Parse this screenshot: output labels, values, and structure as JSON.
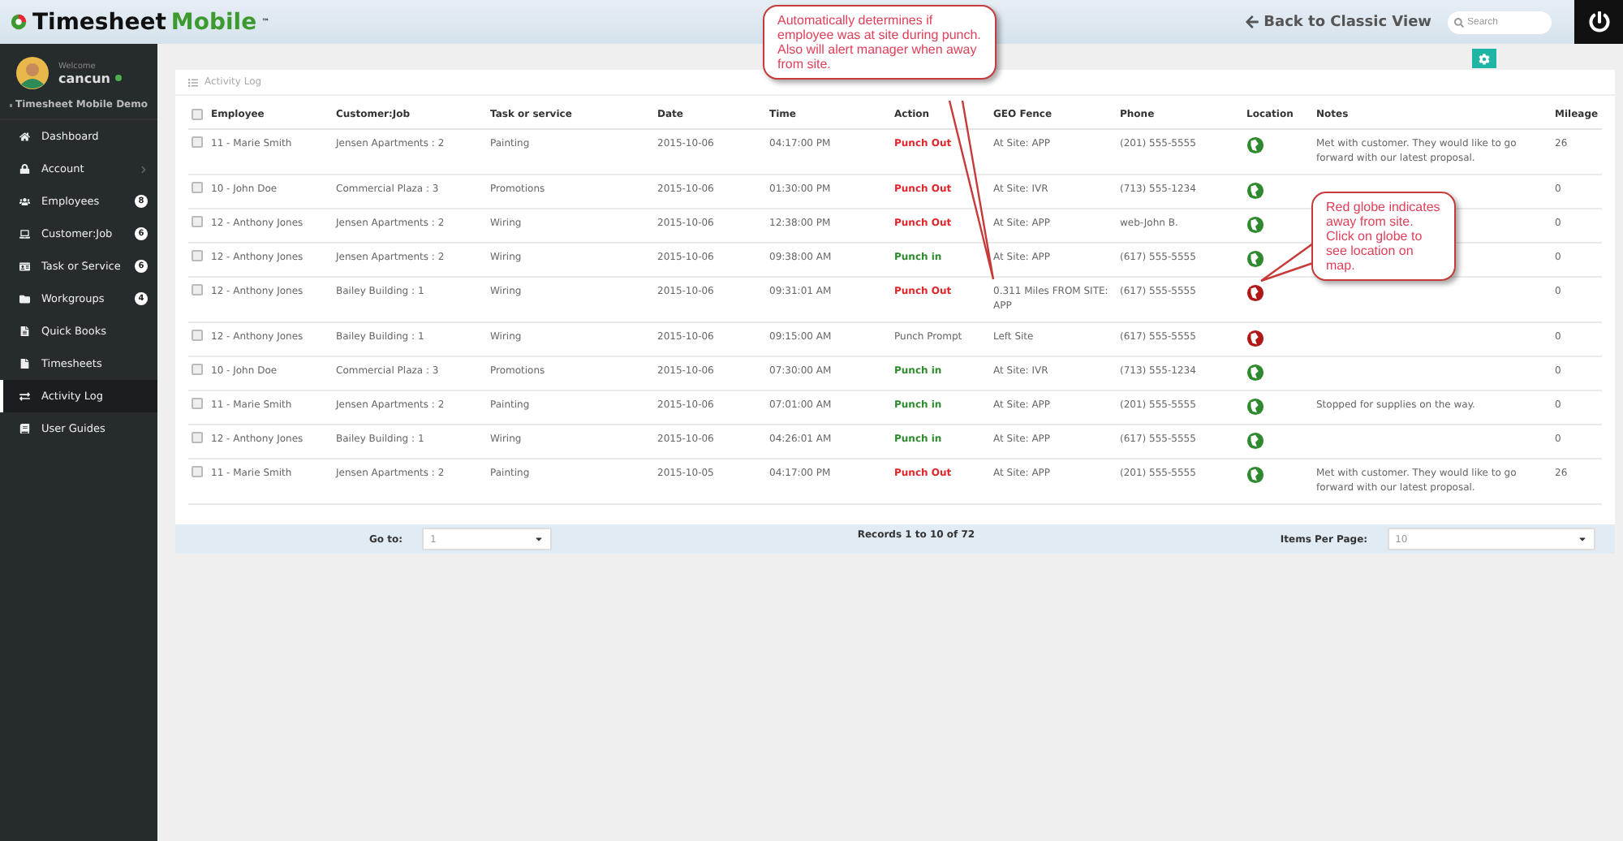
{
  "header": {
    "logo": {
      "word1": "Timesheet",
      "word2": "Mobile",
      "trademark": "™"
    },
    "back_link": "Back to Classic View",
    "search": {
      "placeholder": "Search"
    }
  },
  "sidebar": {
    "welcome": "Welcome",
    "user": "cancun",
    "online": true,
    "company": "Timesheet Mobile Demo",
    "items": [
      {
        "label": "Dashboard",
        "selected": false,
        "chevron": false
      },
      {
        "label": "Account",
        "selected": false,
        "chevron": true
      },
      {
        "label": "Employees",
        "selected": false,
        "chevron": false,
        "badge": "8"
      },
      {
        "label": "Customer:Job",
        "selected": false,
        "chevron": false,
        "badge": "6"
      },
      {
        "label": "Task or Service",
        "selected": false,
        "chevron": false,
        "badge": "6"
      },
      {
        "label": "Workgroups",
        "selected": false,
        "chevron": false,
        "badge": "4"
      },
      {
        "label": "Quick Books",
        "selected": false,
        "chevron": false
      },
      {
        "label": "Timesheets",
        "selected": false,
        "chevron": false
      },
      {
        "label": "Activity Log",
        "selected": true,
        "chevron": false
      },
      {
        "label": "User Guides",
        "selected": false,
        "chevron": false
      }
    ]
  },
  "panel": {
    "title": "Activity Log",
    "select_all_checked": false,
    "columns": [
      "Employee",
      "Customer:Job",
      "Task or service",
      "Date",
      "Time",
      "Action",
      "GEO Fence",
      "Phone",
      "Location",
      "Notes",
      "Mileage"
    ],
    "rows": [
      {
        "checked": false,
        "employee": "11 - Marie Smith",
        "job": "Jensen Apartments : 2",
        "task": "Painting",
        "date": "2015-10-06",
        "time": "04:17:00 PM",
        "action": "Punch Out",
        "kind": "punch_out",
        "geo": "At Site: APP",
        "phone": "(201) 555-5555",
        "away": false,
        "notes": "Met with customer. They would like to go forward with our latest proposal.",
        "mileage": "26"
      },
      {
        "checked": false,
        "employee": "10 - John Doe",
        "job": "Commercial Plaza : 3",
        "task": "Promotions",
        "date": "2015-10-06",
        "time": "01:30:00 PM",
        "action": "Punch Out",
        "kind": "punch_out",
        "geo": "At Site: IVR",
        "phone": "(713) 555-1234",
        "away": false,
        "mileage": "0"
      },
      {
        "checked": false,
        "employee": "12 - Anthony Jones",
        "job": "Jensen Apartments : 2",
        "task": "Wiring",
        "date": "2015-10-06",
        "time": "12:38:00 PM",
        "action": "Punch Out",
        "kind": "punch_out",
        "geo": "At Site: APP",
        "phone": "web-John B.",
        "away": false,
        "mileage": "0"
      },
      {
        "checked": false,
        "employee": "12 - Anthony Jones",
        "job": "Jensen Apartments : 2",
        "task": "Wiring",
        "date": "2015-10-06",
        "time": "09:38:00 AM",
        "action": "Punch in",
        "kind": "punch_in",
        "geo": "At Site: APP",
        "phone": "(617) 555-5555",
        "away": false,
        "mileage": "0"
      },
      {
        "checked": false,
        "employee": "12 - Anthony Jones",
        "job": "Bailey Building : 1",
        "task": "Wiring",
        "date": "2015-10-06",
        "time": "09:31:01 AM",
        "action": "Punch Out",
        "kind": "punch_out",
        "geo": "0.311 Miles FROM SITE: APP",
        "phone": "(617) 555-5555",
        "away": true,
        "mileage": "0"
      },
      {
        "checked": false,
        "employee": "12 - Anthony Jones",
        "job": "Bailey Building : 1",
        "task": "Wiring",
        "date": "2015-10-06",
        "time": "09:15:00 AM",
        "action": "Punch Prompt",
        "kind": "punch_prompt",
        "geo": "Left Site",
        "phone": "(617) 555-5555",
        "away": true,
        "mileage": "0"
      },
      {
        "checked": false,
        "employee": "10 - John Doe",
        "job": "Commercial Plaza : 3",
        "task": "Promotions",
        "date": "2015-10-06",
        "time": "07:30:00 AM",
        "action": "Punch in",
        "kind": "punch_in",
        "geo": "At Site: IVR",
        "phone": "(713) 555-1234",
        "away": false,
        "mileage": "0"
      },
      {
        "checked": false,
        "employee": "11 - Marie Smith",
        "job": "Jensen Apartments : 2",
        "task": "Painting",
        "date": "2015-10-06",
        "time": "07:01:00 AM",
        "action": "Punch in",
        "kind": "punch_in",
        "geo": "At Site: APP",
        "phone": "(201) 555-5555",
        "away": false,
        "notes": "Stopped for supplies on the way.",
        "mileage": "0"
      },
      {
        "checked": false,
        "employee": "12 - Anthony Jones",
        "job": "Bailey Building : 1",
        "task": "Wiring",
        "date": "2015-10-06",
        "time": "04:26:01 AM",
        "action": "Punch in",
        "kind": "punch_in",
        "geo": "At Site: APP",
        "phone": "(617) 555-5555",
        "away": false,
        "mileage": "0"
      },
      {
        "checked": false,
        "employee": "11 - Marie Smith",
        "job": "Jensen Apartments : 2",
        "task": "Painting",
        "date": "2015-10-05",
        "time": "04:17:00 PM",
        "action": "Punch Out",
        "kind": "punch_out",
        "geo": "At Site: APP",
        "phone": "(201) 555-5555",
        "away": false,
        "notes": "Met with customer. They would like to go forward with our latest proposal.",
        "mileage": "26"
      }
    ],
    "footer": {
      "goto_label": "Go to:",
      "goto_value": "1",
      "records": "Records 1 to 10 of 72",
      "per_page_label": "Items Per Page:",
      "per_page_value": "10"
    }
  },
  "callouts": [
    {
      "text": "Automatically determines if employee was at site during punch.  Also will alert manager when away from site."
    },
    {
      "text": "Red globe indicates away from site. Click on globe to see location on map."
    }
  ]
}
